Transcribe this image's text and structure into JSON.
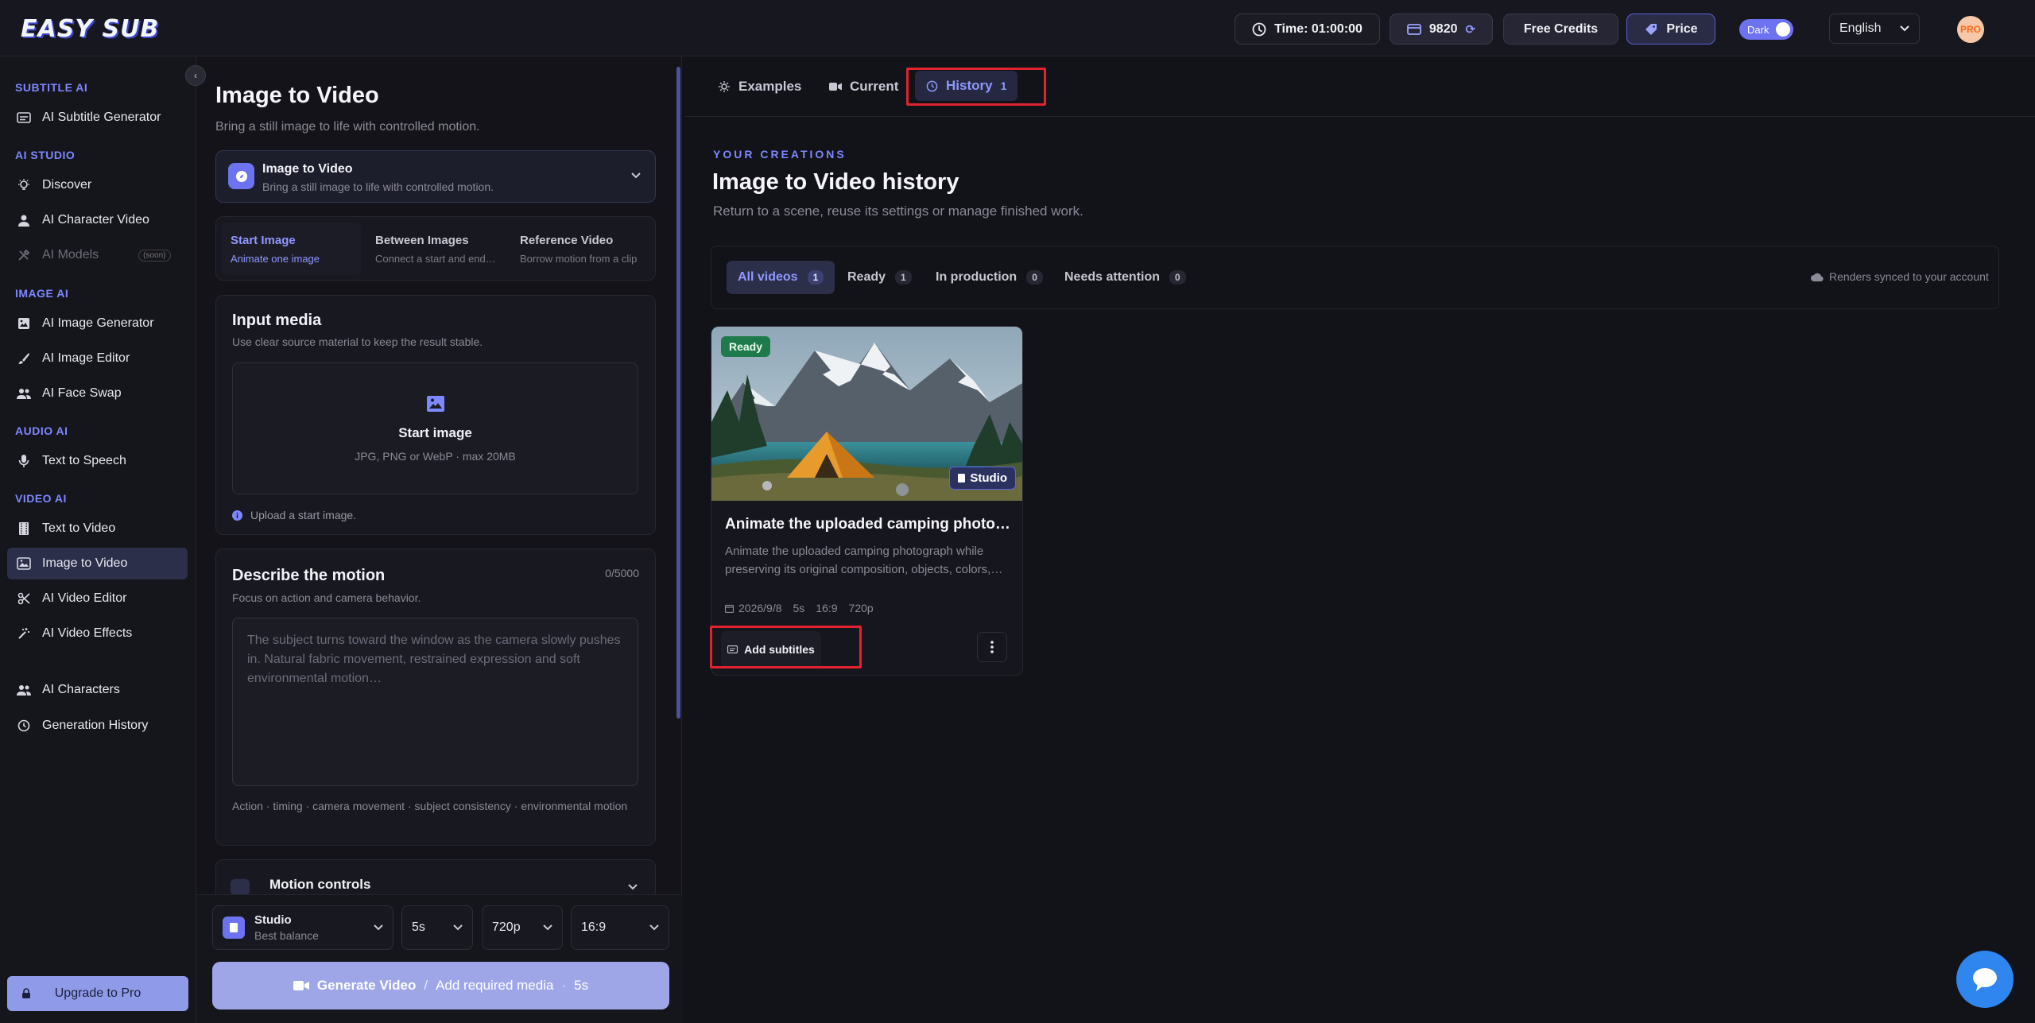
{
  "header": {
    "logo": "EASY SUB",
    "time_label": "Time: 01:00:00",
    "credits": "9820",
    "free_credits": "Free Credits",
    "price": "Price",
    "theme_toggle": "Dark",
    "language": "English",
    "avatar_badge": "PRO"
  },
  "sidebar": {
    "sections": [
      {
        "title": "SUBTITLE AI"
      },
      {
        "title": "AI STUDIO"
      },
      {
        "title": "IMAGE AI"
      },
      {
        "title": "AUDIO AI"
      },
      {
        "title": "VIDEO AI"
      }
    ],
    "items": {
      "subtitle_gen": "AI Subtitle Generator",
      "discover": "Discover",
      "character_video": "AI Character Video",
      "models": "AI Models",
      "models_badge": "(soon)",
      "image_gen": "AI Image Generator",
      "image_editor": "AI Image Editor",
      "face_swap": "AI Face Swap",
      "tts": "Text to Speech",
      "text_to_video": "Text to Video",
      "image_to_video": "Image to Video",
      "video_editor": "AI Video Editor",
      "video_effects": "AI Video Effects",
      "characters": "AI Characters",
      "history": "Generation History"
    },
    "upgrade": "Upgrade to Pro"
  },
  "form": {
    "title": "Image to Video",
    "subtitle": "Bring a still image to life with controlled motion.",
    "mode_title": "Image to Video",
    "mode_desc": "Bring a still image to life with controlled motion.",
    "submodes": [
      {
        "label": "Start Image",
        "desc": "Animate one image"
      },
      {
        "label": "Between Images",
        "desc": "Connect a start and end…"
      },
      {
        "label": "Reference Video",
        "desc": "Borrow motion from a clip"
      }
    ],
    "input_title": "Input media",
    "input_desc": "Use clear source material to keep the result stable.",
    "drop_title": "Start image",
    "drop_desc": "JPG, PNG or WebP · max 20MB",
    "upload_hint": "Upload a start image.",
    "motion_title": "Describe the motion",
    "motion_desc": "Focus on action and camera behavior.",
    "motion_count": "0/5000",
    "motion_placeholder": "The subject turns toward the window as the camera slowly pushes in. Natural fabric movement, restrained expression and soft environmental motion…",
    "motion_tags": "Action · timing · camera movement · subject consistency · environmental motion",
    "controls_title": "Motion controls",
    "model_name": "Studio",
    "model_desc": "Best balance",
    "duration": "5s",
    "resolution": "720p",
    "aspect": "16:9",
    "generate": "Generate Video",
    "generate_hint": "Add required media",
    "generate_duration": "5s"
  },
  "tabs": {
    "examples": "Examples",
    "current": "Current",
    "history": "History",
    "history_count": "1"
  },
  "history": {
    "eyebrow": "YOUR CREATIONS",
    "title": "Image to Video history",
    "subtitle": "Return to a scene, reuse its settings or manage finished work.",
    "filters": [
      {
        "label": "All videos",
        "count": "1"
      },
      {
        "label": "Ready",
        "count": "1"
      },
      {
        "label": "In production",
        "count": "0"
      },
      {
        "label": "Needs attention",
        "count": "0"
      }
    ],
    "sync_note": "Renders synced to your account"
  },
  "video_card": {
    "status": "Ready",
    "model_badge": "Studio",
    "title": "Animate the uploaded camping photo…",
    "desc_line1": "Animate the uploaded camping photograph while",
    "desc_line2": "preserving its original composition, objects, colors,…",
    "date": "2026/9/8",
    "duration": "5s",
    "aspect": "16:9",
    "resolution": "720p",
    "add_subtitles": "Add subtitles"
  },
  "colors": {
    "accent": "#7d88ff",
    "highlight_box": "#e2232f",
    "ready_badge": "#1f7a4b",
    "chat": "#2f86ef"
  }
}
